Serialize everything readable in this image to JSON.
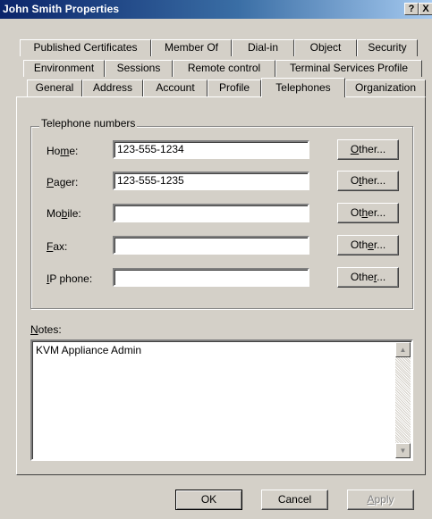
{
  "window": {
    "title": "John Smith Properties",
    "help_label": "?",
    "close_label": "X"
  },
  "tabs": {
    "row1": [
      "Published Certificates",
      "Member Of",
      "Dial-in",
      "Object",
      "Security"
    ],
    "row2": [
      "Environment",
      "Sessions",
      "Remote control",
      "Terminal Services Profile"
    ],
    "row3": [
      "General",
      "Address",
      "Account",
      "Profile",
      "Telephones",
      "Organization"
    ],
    "selected": "Telephones"
  },
  "telephone_numbers": {
    "group_label": "Telephone numbers",
    "home": {
      "label_pre": "Ho",
      "label_key": "m",
      "label_post": "e:",
      "value": "123-555-1234"
    },
    "pager": {
      "label_pre": "",
      "label_key": "P",
      "label_post": "ager:",
      "value": "123-555-1235"
    },
    "mobile": {
      "label_pre": "Mo",
      "label_key": "b",
      "label_post": "ile:",
      "value": ""
    },
    "fax": {
      "label_pre": "",
      "label_key": "F",
      "label_post": "ax:",
      "value": ""
    },
    "ip_phone": {
      "label_pre": "",
      "label_key": "I",
      "label_post": "P phone:",
      "value": ""
    },
    "other_buttons": [
      {
        "pre": "",
        "key": "O",
        "post": "ther..."
      },
      {
        "pre": "O",
        "key": "t",
        "post": "her..."
      },
      {
        "pre": "Ot",
        "key": "h",
        "post": "er..."
      },
      {
        "pre": "Oth",
        "key": "e",
        "post": "r..."
      },
      {
        "pre": "Othe",
        "key": "r",
        "post": "..."
      }
    ]
  },
  "notes": {
    "label_key": "N",
    "label_post": "otes:",
    "value": "KVM Appliance Admin"
  },
  "buttons": {
    "ok": "OK",
    "cancel": "Cancel",
    "apply_key": "A",
    "apply_post": "pply"
  }
}
